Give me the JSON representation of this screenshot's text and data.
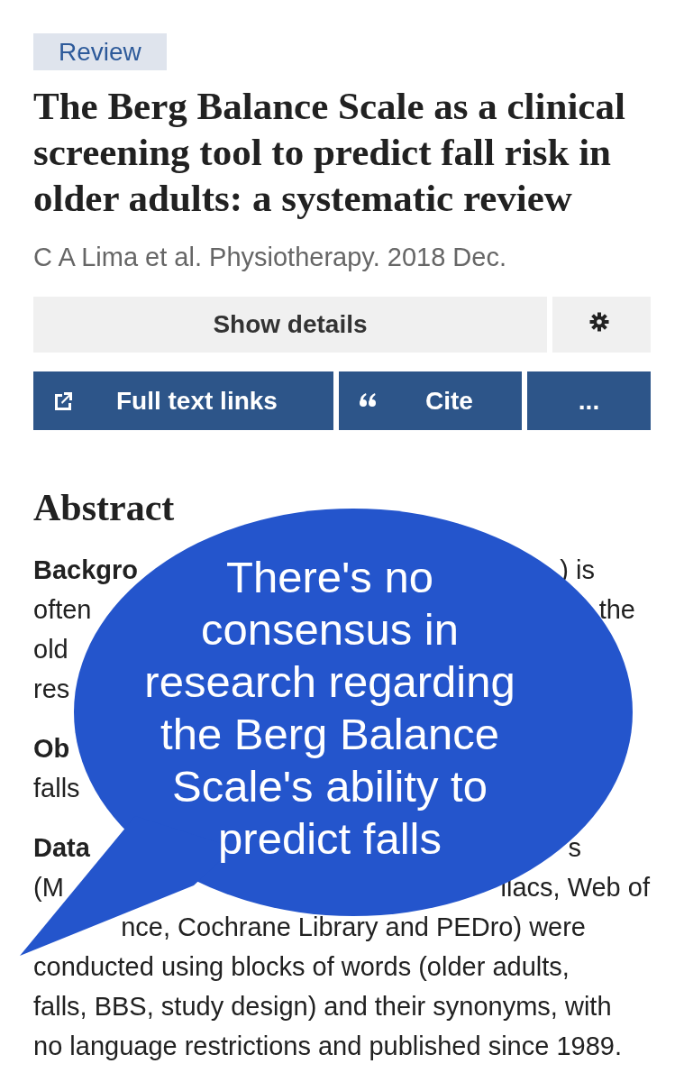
{
  "article": {
    "type_tag": "Review",
    "title": "The Berg Balance Scale as a clinical screening tool to predict fall risk in older adults: a systematic review",
    "citation": "C A Lima et al. Physiotherapy. 2018 Dec."
  },
  "actions": [
    {
      "label": "Show details",
      "kind": "details"
    },
    {
      "kind": "settings"
    }
  ],
  "buttons": [
    {
      "label": "Full text links",
      "kind": "external"
    },
    {
      "label": "Cite",
      "kind": "quote"
    },
    {
      "label": "...",
      "kind": "more"
    }
  ],
  "abstract": {
    "heading": "Abstract",
    "lines": [
      {
        "left": "Backgro",
        "label": true,
        "right": ") is"
      },
      {
        "left": "often",
        "label": false,
        "right": "the"
      },
      {
        "left": "old",
        "label": false
      },
      {
        "left": "res",
        "label": false
      },
      {
        "left": "Ob",
        "label": true
      },
      {
        "left": "falls",
        "label": false
      },
      {
        "left": "Data",
        "label": true,
        "right": "s"
      },
      {
        "left": "(M",
        "label": false,
        "right": "ilacs, Web of"
      },
      {
        "label": false,
        "right": "nce, Cochrane Library and PEDro) were"
      },
      {
        "left": "conducted using blocks of words (older adults,",
        "label": false
      },
      {
        "left": "falls, BBS, study design) and their synonyms, with",
        "label": false
      },
      {
        "left": "no language restrictions and published since 1989.",
        "label": false
      }
    ]
  },
  "callout": {
    "text": "There's no consensus in research regarding the Berg Balance Scale's ability to predict falls"
  }
}
